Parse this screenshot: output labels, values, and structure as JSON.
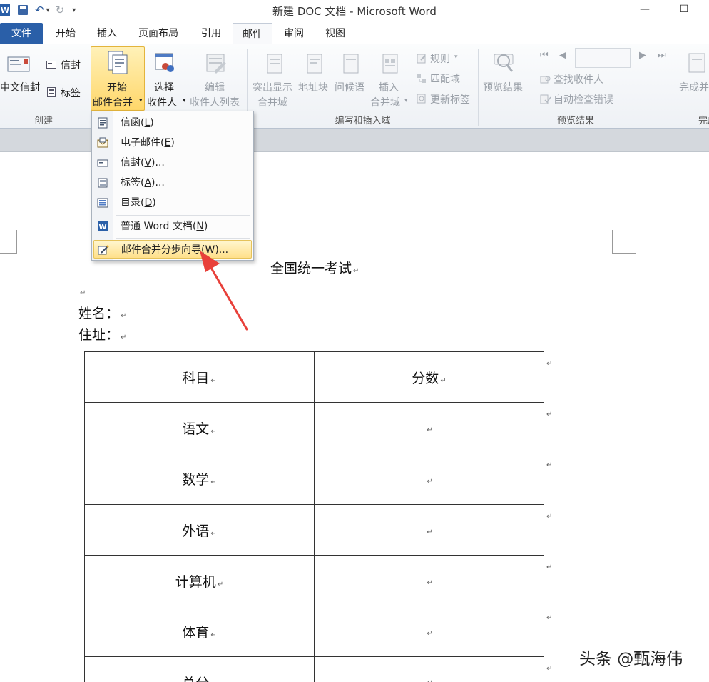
{
  "window": {
    "title": "新建 DOC 文档 - Microsoft Word",
    "minimize_glyph": "—",
    "maximize_glyph": "☐"
  },
  "quick_access": {
    "app_icon": "W",
    "dropdown_glyph": "▾",
    "customize_glyph": "▾"
  },
  "tabs": [
    "文件",
    "开始",
    "插入",
    "页面布局",
    "引用",
    "邮件",
    "审阅",
    "视图"
  ],
  "active_tab": "邮件",
  "ribbon": {
    "create": {
      "label": "创建",
      "chinese_envelope": "中文信封",
      "envelope": "信封",
      "labels": "标签"
    },
    "start_merge": {
      "line1": "开始",
      "line2": "邮件合并",
      "arrow": "▾",
      "select_line1": "选择",
      "select_line2": "收件人",
      "edit_line1": "编辑",
      "edit_line2": "收件人列表"
    },
    "write_insert": {
      "label": "编写和插入域",
      "highlight_line1": "突出显示",
      "highlight_line2": "合并域",
      "address_block": "地址块",
      "greeting": "问候语",
      "insert_line1": "插入",
      "insert_line2": "合并域",
      "rules": "规则",
      "match_fields": "匹配域",
      "update_labels": "更新标签"
    },
    "preview": {
      "label": "预览结果",
      "preview_results": "预览结果",
      "find_recipient": "查找收件人",
      "auto_check": "自动检查错误"
    },
    "finish": {
      "line1": "完成并",
      "label": "完成"
    }
  },
  "dropdown": {
    "items": [
      {
        "label": "信函(",
        "key": "L",
        "suffix": ")"
      },
      {
        "label": "电子邮件(",
        "key": "E",
        "suffix": ")"
      },
      {
        "label": "信封(",
        "key": "V",
        "suffix": ")..."
      },
      {
        "label": "标签(",
        "key": "A",
        "suffix": ")..."
      },
      {
        "label": "目录(",
        "key": "D",
        "suffix": ")"
      },
      {
        "label": "普通 Word 文档(",
        "key": "N",
        "suffix": ")"
      },
      {
        "label": "邮件合并分步向导(",
        "key": "W",
        "suffix": ")..."
      }
    ]
  },
  "document": {
    "paragraph_mark": "↵",
    "heading": "全国统一考试",
    "name_label": "姓名：",
    "address_label": "住址：",
    "table": {
      "headers": [
        "科目",
        "分数"
      ],
      "rows": [
        [
          "语文",
          ""
        ],
        [
          "数学",
          ""
        ],
        [
          "外语",
          ""
        ],
        [
          "计算机",
          ""
        ],
        [
          "体育",
          ""
        ],
        [
          "总分",
          ""
        ]
      ]
    }
  },
  "watermark": "头条 @甄海伟",
  "colors": {
    "file_tab": "#2a5fa8",
    "highlight": "#ffd76a",
    "arrow": "#e8403a"
  }
}
